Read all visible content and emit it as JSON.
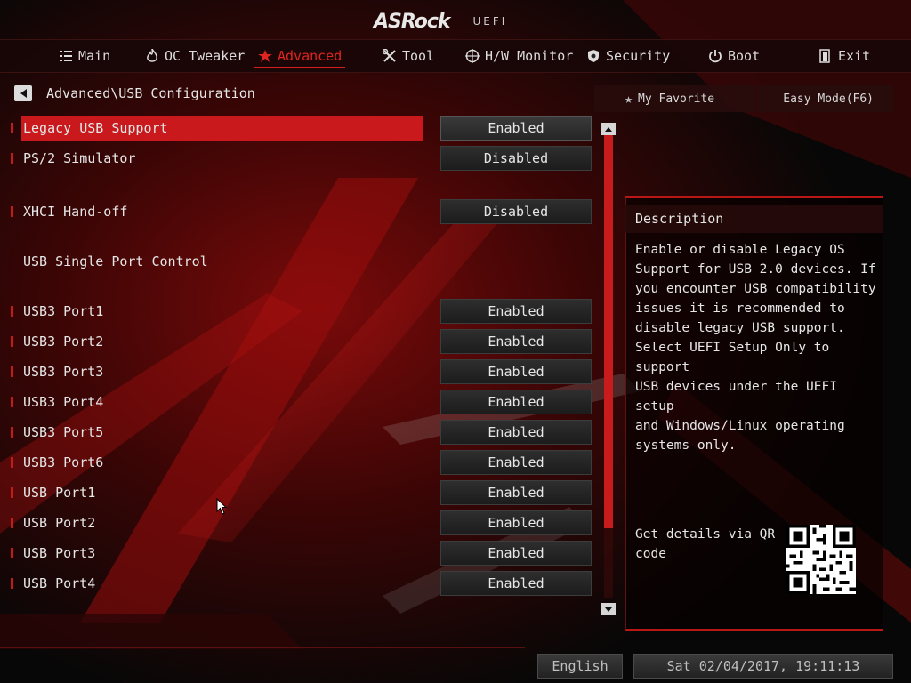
{
  "header": {
    "brand": "ASRock",
    "brand_sub": "UEFI"
  },
  "menu": [
    {
      "label": "Main",
      "icon": "list-icon",
      "active": false
    },
    {
      "label": "OC Tweaker",
      "icon": "flame-icon",
      "active": false
    },
    {
      "label": "Advanced",
      "icon": "star-icon",
      "active": true
    },
    {
      "label": "Tool",
      "icon": "tools-icon",
      "active": false
    },
    {
      "label": "H/W Monitor",
      "icon": "monitor-icon",
      "active": false
    },
    {
      "label": "Security",
      "icon": "shield-icon",
      "active": false
    },
    {
      "label": "Boot",
      "icon": "power-icon",
      "active": false
    },
    {
      "label": "Exit",
      "icon": "exit-icon",
      "active": false
    }
  ],
  "breadcrumb": "Advanced\\USB Configuration",
  "top_buttons": {
    "favorite": "My Favorite",
    "easy_mode": "Easy Mode(F6)"
  },
  "settings": {
    "legacy_usb": {
      "label": "Legacy USB Support",
      "value": "Enabled"
    },
    "ps2_sim": {
      "label": "PS/2 Simulator",
      "value": "Disabled"
    },
    "xhci": {
      "label": "XHCI Hand-off",
      "value": "Disabled"
    },
    "single_port_header": "USB Single Port Control",
    "ports": [
      {
        "label": "USB3 Port1",
        "value": "Enabled"
      },
      {
        "label": "USB3 Port2",
        "value": "Enabled"
      },
      {
        "label": "USB3 Port3",
        "value": "Enabled"
      },
      {
        "label": "USB3 Port4",
        "value": "Enabled"
      },
      {
        "label": "USB3 Port5",
        "value": "Enabled"
      },
      {
        "label": "USB3 Port6",
        "value": "Enabled"
      },
      {
        "label": "USB Port1",
        "value": "Enabled"
      },
      {
        "label": "USB Port2",
        "value": "Enabled"
      },
      {
        "label": "USB Port3",
        "value": "Enabled"
      },
      {
        "label": "USB Port4",
        "value": "Enabled"
      }
    ]
  },
  "description": {
    "title": "Description",
    "text": "Enable or disable Legacy OS\nSupport for USB 2.0 devices. If\nyou encounter USB compatibility\nissues it is recommended to\ndisable legacy USB support.\nSelect UEFI Setup Only to support\nUSB devices under the UEFI setup\nand Windows/Linux operating\nsystems only.",
    "qr_text": "Get details via QR code"
  },
  "footer": {
    "language": "English",
    "datetime": "Sat 02/04/2017, 19:11:13"
  },
  "colors": {
    "accent": "#c9191c",
    "background": "#070707"
  }
}
